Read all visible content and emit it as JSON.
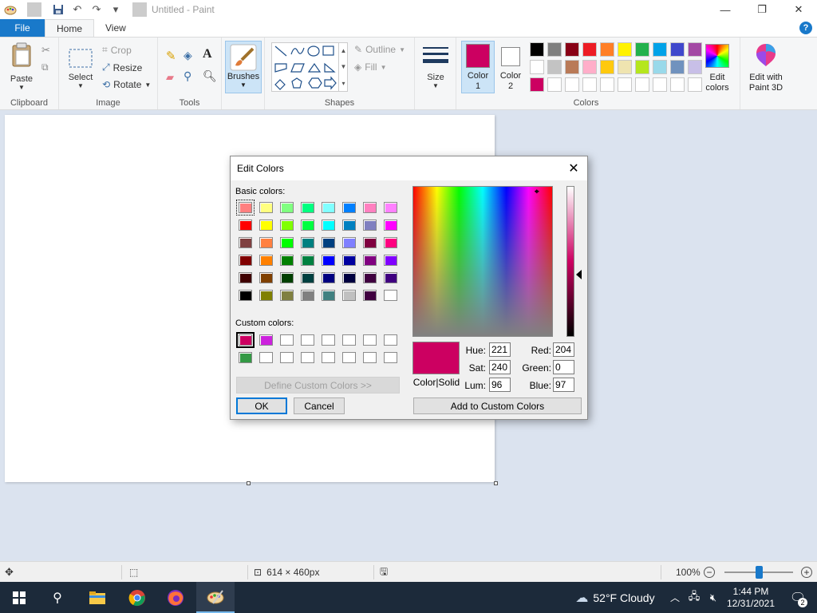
{
  "window": {
    "title": "Untitled - Paint"
  },
  "tabs": {
    "file": "File",
    "home": "Home",
    "view": "View",
    "help": "?"
  },
  "ribbon": {
    "clipboard": {
      "label": "Clipboard",
      "paste": "Paste"
    },
    "image": {
      "label": "Image",
      "select": "Select",
      "crop": "Crop",
      "resize": "Resize",
      "rotate": "Rotate"
    },
    "tools": {
      "label": "Tools"
    },
    "brushes": {
      "label": "Brushes"
    },
    "shapes": {
      "label": "Shapes",
      "outline": "Outline",
      "fill": "Fill"
    },
    "size": {
      "label": "Size"
    },
    "colors": {
      "label": "Colors",
      "color1_line1": "Color",
      "color1_line2": "1",
      "color2_line1": "Color",
      "color2_line2": "2",
      "edit_line1": "Edit",
      "edit_line2": "colors",
      "paint3d_line1": "Edit with",
      "paint3d_line2": "Paint 3D",
      "color1_value": "#cc0061",
      "color2_value": "#ffffff",
      "palette_row1": [
        "#000000",
        "#7f7f7f",
        "#880015",
        "#ed1c24",
        "#ff7f27",
        "#fff200",
        "#22b14c",
        "#00a2e8",
        "#3f48cc",
        "#a349a4"
      ],
      "palette_row2": [
        "#ffffff",
        "#c3c3c3",
        "#b97a57",
        "#ffaec9",
        "#ffc90e",
        "#efe4b0",
        "#b5e61d",
        "#99d9ea",
        "#7092be",
        "#c8bfe7"
      ],
      "palette_row3": [
        "#cc0061",
        "#ffffff",
        "#ffffff",
        "#ffffff",
        "#ffffff",
        "#ffffff",
        "#ffffff",
        "#ffffff",
        "#ffffff",
        "#ffffff"
      ]
    }
  },
  "statusbar": {
    "size": "614 × 460px",
    "zoom": "100%",
    "zoom_fraction": 0.5
  },
  "taskbar": {
    "weather": "52°F  Cloudy",
    "time": "1:44 PM",
    "date": "12/31/2021",
    "notifications": "2"
  },
  "dialog": {
    "title": "Edit Colors",
    "basic_label": "Basic colors:",
    "custom_label": "Custom colors:",
    "define_button": "Define Custom Colors >>",
    "ok": "OK",
    "cancel": "Cancel",
    "add_button": "Add to Custom Colors",
    "color_solid": "Color|Solid",
    "preview_color": "#cc0061",
    "hue_label": "Hue:",
    "hue": "221",
    "sat_label": "Sat:",
    "sat": "240",
    "lum_label": "Lum:",
    "lum": "96",
    "red_label": "Red:",
    "red": "204",
    "green_label": "Green:",
    "green": "0",
    "blue_label": "Blue:",
    "blue": "97",
    "basic_colors": [
      [
        "#ff8080",
        "#ffff80",
        "#80ff80",
        "#00ff80",
        "#80ffff",
        "#0080ff",
        "#ff80c0",
        "#ff80ff"
      ],
      [
        "#ff0000",
        "#ffff00",
        "#80ff00",
        "#00ff40",
        "#00ffff",
        "#0080c0",
        "#8080c0",
        "#ff00ff"
      ],
      [
        "#804040",
        "#ff8040",
        "#00ff00",
        "#008080",
        "#004080",
        "#8080ff",
        "#800040",
        "#ff0080"
      ],
      [
        "#800000",
        "#ff8000",
        "#008000",
        "#008040",
        "#0000ff",
        "#0000a0",
        "#800080",
        "#8000ff"
      ],
      [
        "#400000",
        "#804000",
        "#004000",
        "#004040",
        "#000080",
        "#000040",
        "#400040",
        "#400080"
      ],
      [
        "#000000",
        "#808000",
        "#808040",
        "#808080",
        "#408080",
        "#c0c0c0",
        "#400040",
        "#ffffff"
      ]
    ],
    "custom_colors": [
      [
        "#cc0061",
        "#cc22dd",
        "#ffffff",
        "#ffffff",
        "#ffffff",
        "#ffffff",
        "#ffffff",
        "#ffffff"
      ],
      [
        "#339944",
        "#ffffff",
        "#ffffff",
        "#ffffff",
        "#ffffff",
        "#ffffff",
        "#ffffff",
        "#ffffff"
      ]
    ]
  }
}
